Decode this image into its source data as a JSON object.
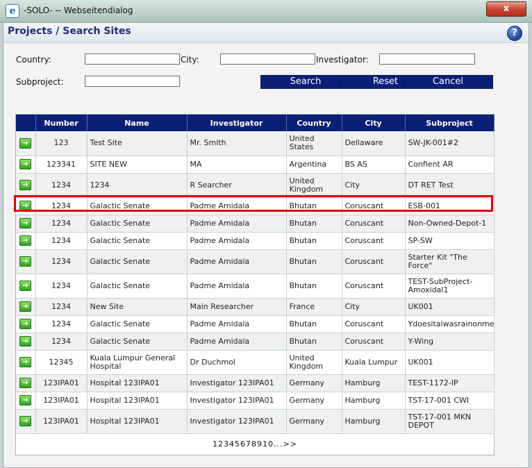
{
  "window": {
    "title": "-SOLO- -- Webseitendialog",
    "close_label": "x",
    "icon": "ie-icon"
  },
  "header": {
    "title": "Projects / Search Sites",
    "help_label": "?"
  },
  "search": {
    "country_label": "Country:",
    "city_label": "City:",
    "investigator_label": "Investigator:",
    "subproject_label": "Subproject:",
    "country_value": "",
    "city_value": "",
    "investigator_value": "",
    "subproject_value": "",
    "search_label": "Search",
    "reset_label": "Reset",
    "cancel_label": "Cancel"
  },
  "table": {
    "headers": {
      "number": "Number",
      "name": "Name",
      "investigator": "Investigator",
      "country": "Country",
      "city": "City",
      "subproject": "Subproject"
    },
    "rows": [
      {
        "number": "123",
        "name": "Test Site",
        "investigator": "Mr. Smith",
        "country": "United States",
        "city": "Dellaware",
        "subproject": "SW-JK-001#2",
        "h": 35
      },
      {
        "number": "123341",
        "name": "SITE NEW",
        "investigator": "MA",
        "country": "Argentina",
        "city": "BS AS",
        "subproject": "Confient AR",
        "h": 25
      },
      {
        "number": "1234",
        "name": "1234",
        "investigator": "R Searcher",
        "country": "United Kingdom",
        "city": "City",
        "subproject": "DT RET Test",
        "h": 35
      },
      {
        "number": "1234",
        "name": "Galactic Senate",
        "investigator": "Padme Amidala",
        "country": "Bhutan",
        "city": "Coruscant",
        "subproject": "ESB-001",
        "h": 25
      },
      {
        "number": "1234",
        "name": "Galactic Senate",
        "investigator": "Padme Amidala",
        "country": "Bhutan",
        "city": "Coruscant",
        "subproject": "Non-Owned-Depot-1",
        "h": 25
      },
      {
        "number": "1234",
        "name": "Galactic Senate",
        "investigator": "Padme Amidala",
        "country": "Bhutan",
        "city": "Coruscant",
        "subproject": "SP-SW",
        "h": 25
      },
      {
        "number": "1234",
        "name": "Galactic Senate",
        "investigator": "Padme Amidala",
        "country": "Bhutan",
        "city": "Coruscant",
        "subproject": "Starter Kit \"The Force\"",
        "h": 35
      },
      {
        "number": "1234",
        "name": "Galactic Senate",
        "investigator": "Padme Amidala",
        "country": "Bhutan",
        "city": "Coruscant",
        "subproject": "TEST-SubProject-Amoxidal1",
        "h": 35
      },
      {
        "number": "1234",
        "name": "New Site",
        "investigator": "Main Researcher",
        "country": "France",
        "city": "City",
        "subproject": "UK001",
        "h": 25
      },
      {
        "number": "1234",
        "name": "Galactic Senate",
        "investigator": "Padme Amidala",
        "country": "Bhutan",
        "city": "Coruscant",
        "subproject": "Ydoesitalwasrainonme",
        "h": 25
      },
      {
        "number": "1234",
        "name": "Galactic Senate",
        "investigator": "Padme Amidala",
        "country": "Bhutan",
        "city": "Coruscant",
        "subproject": "Y-Wing",
        "h": 25
      },
      {
        "number": "12345",
        "name": "Kuala Lumpur General Hospital",
        "investigator": "Dr Duchmol",
        "country": "United Kingdom",
        "city": "Kuala Lumpur",
        "subproject": "UK001",
        "h": 35
      },
      {
        "number": "123IPA01",
        "name": "Hospital 123IPA01",
        "investigator": "Investigator 123IPA01",
        "country": "Germany",
        "city": "Hamburg",
        "subproject": "TEST-1172-IP",
        "h": 25
      },
      {
        "number": "123IPA01",
        "name": "Hospital 123IPA01",
        "investigator": "Investigator 123IPA01",
        "country": "Germany",
        "city": "Hamburg",
        "subproject": "TST-17-001 CWI",
        "h": 25
      },
      {
        "number": "123IPA01",
        "name": "Hospital 123IPA01",
        "investigator": "Investigator 123IPA01",
        "country": "Germany",
        "city": "Hamburg",
        "subproject": "TST-17-001 MKN DEPOT",
        "h": 35
      }
    ],
    "row_icon": "arrow-right-icon"
  },
  "pager": {
    "text": "12345678910...>>"
  },
  "highlight_color": "#e00000"
}
